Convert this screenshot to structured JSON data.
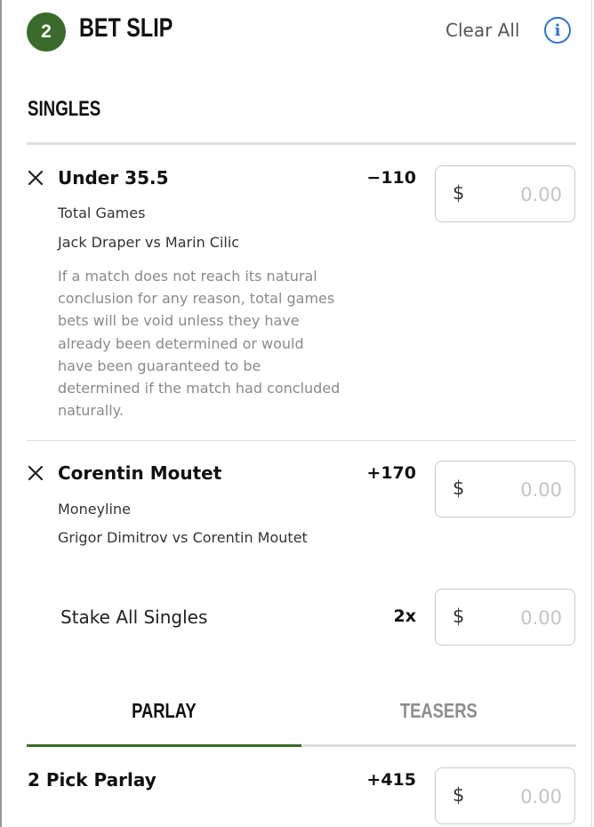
{
  "header": {
    "count": "2",
    "title": "BET SLIP",
    "clear_all": "Clear All",
    "info_icon": "info-icon"
  },
  "singles": {
    "heading": "SINGLES",
    "selections": [
      {
        "name": "Under 35.5",
        "odds": "−110",
        "market": "Total Games",
        "event": "Jack Draper vs Marin Cilic",
        "note": "If a match does not reach its natural conclusion for any reason, total games bets will be void unless they have already been determined or would have been guaranteed to be determined if the match had concluded naturally.",
        "stake_currency": "$",
        "stake_placeholder": "0.00"
      },
      {
        "name": "Corentin Moutet",
        "odds": "+170",
        "market": "Moneyline",
        "event": "Grigor Dimitrov vs Corentin Moutet",
        "stake_currency": "$",
        "stake_placeholder": "0.00"
      }
    ],
    "stake_all": {
      "label": "Stake All Singles",
      "multiplier": "2x",
      "stake_currency": "$",
      "stake_placeholder": "0.00"
    }
  },
  "tabs": {
    "items": [
      {
        "label": "PARLAY",
        "active": true
      },
      {
        "label": "TEASERS",
        "active": false
      }
    ]
  },
  "parlay": {
    "name": "2 Pick Parlay",
    "odds": "+415",
    "stake_currency": "$",
    "stake_placeholder": "0.00"
  },
  "colors": {
    "accent_green": "#3a6b2a",
    "info_blue": "#2b73d6"
  }
}
